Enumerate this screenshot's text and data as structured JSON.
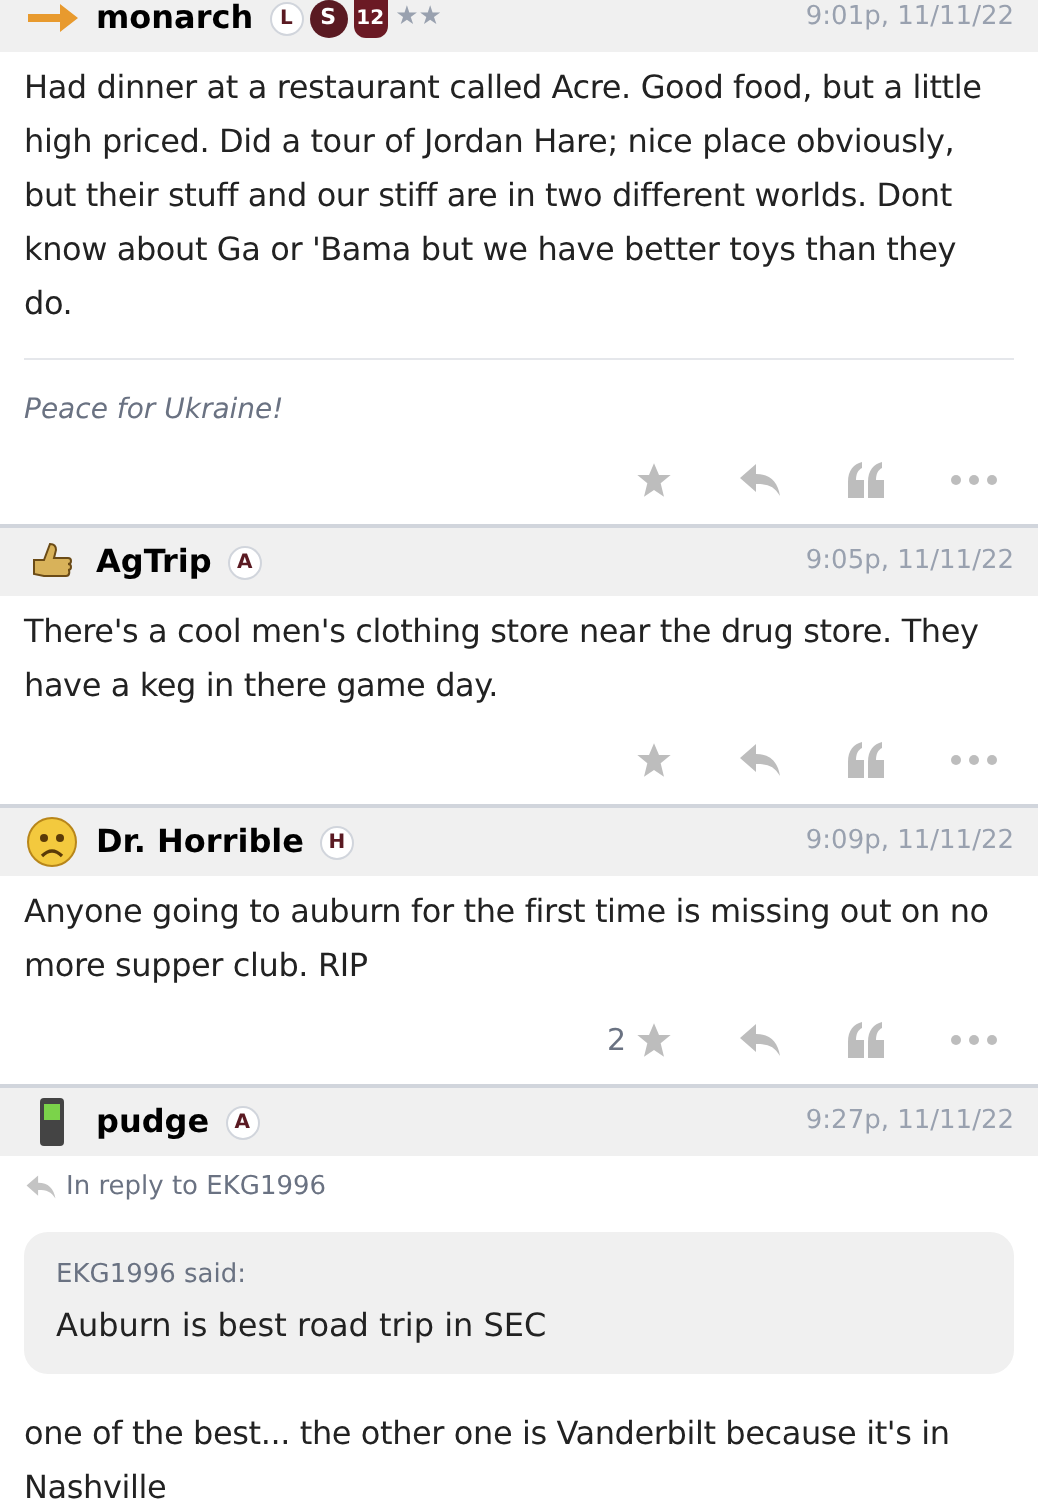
{
  "posts": [
    {
      "author": "monarch",
      "badges": [
        {
          "kind": "outline",
          "text": "L"
        },
        {
          "kind": "filled",
          "text": "S"
        },
        {
          "kind": "shield",
          "text": "12"
        }
      ],
      "rating": "★★",
      "time": "9:01p, 11/11/22",
      "body": [
        "Had dinner at a restaurant called Acre. Good food, but a little high priced. Did a tour of Jordan Hare; nice place obviously, but their stuff and our stiff are in two different worlds. Dont know about Ga or 'Bama but we have better toys than they do."
      ],
      "signature": "Peace for Ukraine!"
    },
    {
      "author": "AgTrip",
      "badges": [
        {
          "kind": "outline",
          "text": "A"
        }
      ],
      "time": "9:05p, 11/11/22",
      "body": [
        "There's a cool men's clothing store near the drug store. They have a keg in there game day."
      ]
    },
    {
      "author": "Dr. Horrible",
      "badges": [
        {
          "kind": "outline",
          "text": "H"
        }
      ],
      "time": "9:09p, 11/11/22",
      "body": [
        "Anyone going to auburn for the first time is missing out on no more supper club. RIP"
      ],
      "star_count": "2"
    },
    {
      "author": "pudge",
      "badges": [
        {
          "kind": "outline",
          "text": "A"
        }
      ],
      "time": "9:27p, 11/11/22",
      "reply_to": "In reply to EKG1996",
      "quote": {
        "said": "EKG1996 said:",
        "text": "Auburn is best road trip in SEC"
      },
      "body": [
        "one of the best... the other one is Vanderbilt because it's in Nashville"
      ]
    }
  ]
}
